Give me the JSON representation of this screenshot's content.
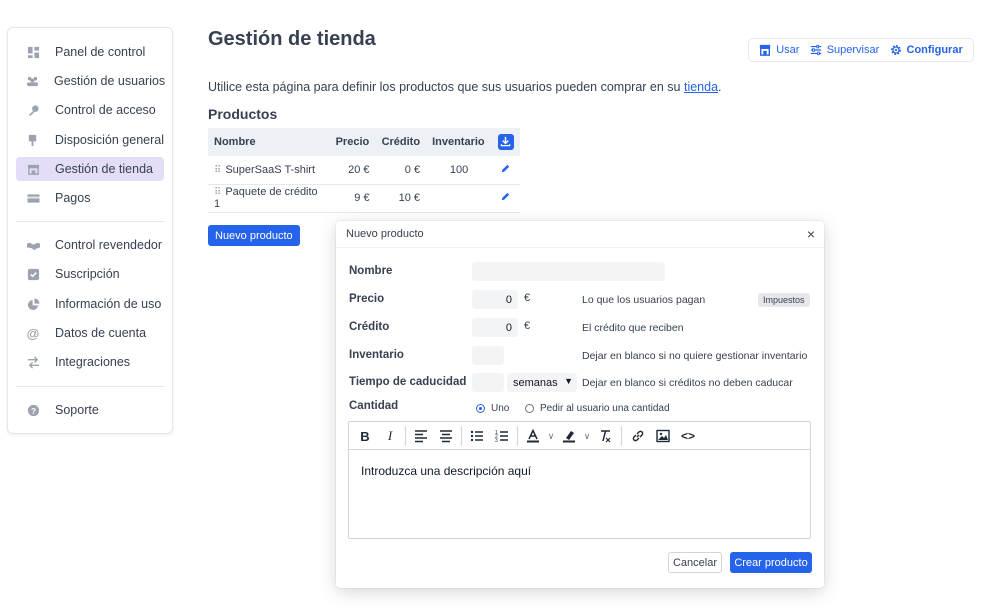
{
  "sidebar": {
    "items": [
      {
        "label": "Panel de control",
        "icon": "dashboard-icon"
      },
      {
        "label": "Gestión de usuarios",
        "icon": "users-icon"
      },
      {
        "label": "Control de acceso",
        "icon": "key-icon"
      },
      {
        "label": "Disposición general",
        "icon": "layout-icon"
      },
      {
        "label": "Gestión de tienda",
        "icon": "store-icon",
        "active": true
      },
      {
        "label": "Pagos",
        "icon": "credit-card-icon"
      },
      {
        "label": "Control revendedor",
        "icon": "handshake-icon"
      },
      {
        "label": "Suscripción",
        "icon": "checkbox-icon"
      },
      {
        "label": "Información de uso",
        "icon": "pie-chart-icon"
      },
      {
        "label": "Datos de cuenta",
        "icon": "at-icon"
      },
      {
        "label": "Integraciones",
        "icon": "arrows-icon"
      },
      {
        "label": "Soporte",
        "icon": "help-icon"
      }
    ]
  },
  "header": {
    "title": "Gestión de tienda",
    "modes": {
      "use": "Usar",
      "supervise": "Supervisar",
      "configure": "Configurar"
    }
  },
  "intro": {
    "text": "Utilice esta página para definir los productos que sus usuarios pueden comprar en su ",
    "link": "tienda",
    "end": "."
  },
  "products": {
    "title": "Productos",
    "columns": {
      "name": "Nombre",
      "price": "Precio",
      "credit": "Crédito",
      "inventory": "Inventario"
    },
    "rows": [
      {
        "name": "SuperSaaS T-shirt",
        "price": "20 €",
        "credit": "0 €",
        "inventory": "100"
      },
      {
        "name": "Paquete de crédito 1",
        "price": "9 €",
        "credit": "10 €",
        "inventory": ""
      }
    ],
    "new_button": "Nuevo producto"
  },
  "modal": {
    "title": "Nuevo producto",
    "close": "×",
    "name_label": "Nombre",
    "name_value": "",
    "price_label": "Precio",
    "price_value": "0",
    "price_unit": "€",
    "price_help": "Lo que los usuarios pagan",
    "tax_badge": "Impuestos",
    "credit_label": "Crédito",
    "credit_value": "0",
    "credit_unit": "€",
    "credit_help": "El crédito que reciben",
    "inventory_label": "Inventario",
    "inventory_value": "",
    "inventory_help": "Dejar en blanco si no quiere gestionar inventario",
    "expiry_label": "Tiempo de caducidad",
    "expiry_value": "",
    "expiry_unit": "semanas",
    "expiry_help": "Dejar en blanco si créditos no deben caducar",
    "quantity_label": "Cantidad",
    "quantity_one": "Uno",
    "quantity_ask": "Pedir al usuario una cantidad",
    "quantity_selected": "Uno",
    "editor_text": "Introduzca una descripción aquí",
    "cancel": "Cancelar",
    "create": "Crear producto"
  },
  "colors": {
    "accent": "#2563eb",
    "active_item": "#e3ddf7"
  }
}
